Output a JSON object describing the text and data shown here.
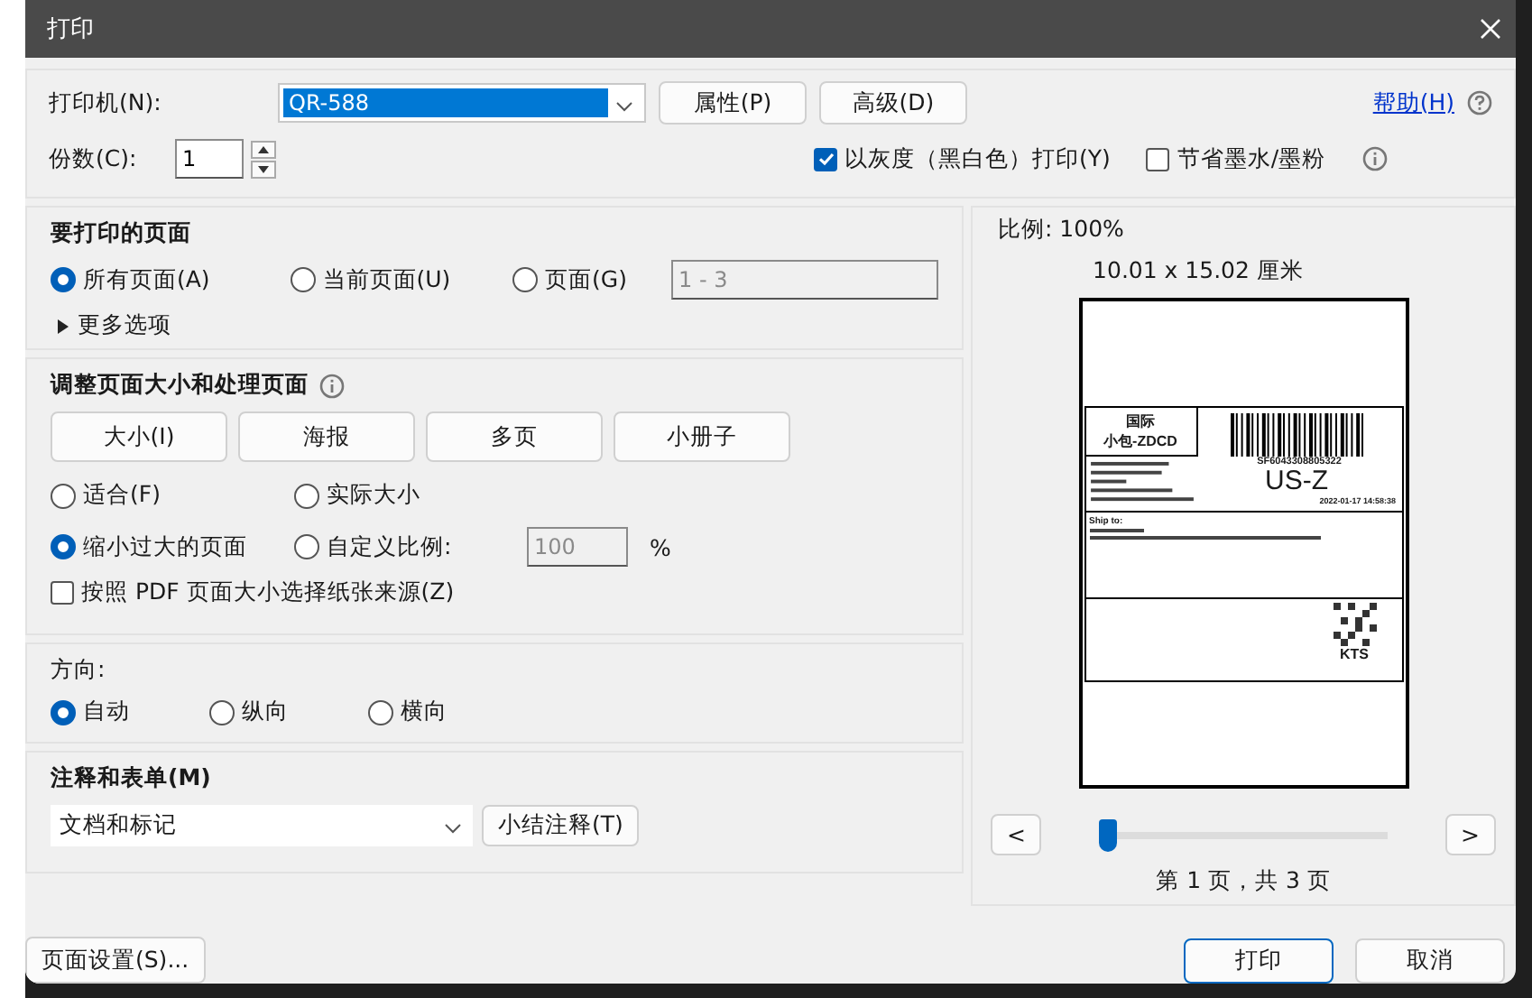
{
  "window": {
    "title": "打印"
  },
  "printer": {
    "label": "打印机(N):",
    "value": "QR-588",
    "buttons": [
      "属性(P)",
      "高级(D)"
    ]
  },
  "help_link": "帮助(H)",
  "copies": {
    "label": "份数(C):",
    "value": "1"
  },
  "options": [
    {
      "label": "以灰度（黑白色）打印(Y)",
      "checked": true
    },
    {
      "label": "节省墨水/墨粉",
      "checked": false
    }
  ],
  "pages_section": {
    "title": "要打印的页面",
    "radios": [
      {
        "label": "所有页面(A)",
        "selected": true
      },
      {
        "label": "当前页面(U)",
        "selected": false
      },
      {
        "label": "页面(G)",
        "selected": false
      }
    ],
    "range_value": "1 - 3",
    "more": "更多选项"
  },
  "size_section": {
    "title": "调整页面大小和处理页面",
    "modes": [
      "大小(I)",
      "海报",
      "多页",
      "小册子"
    ],
    "radios": [
      {
        "label": "适合(F)",
        "selected": false
      },
      {
        "label": "实际大小",
        "selected": false
      },
      {
        "label": "缩小过大的页面",
        "selected": true
      },
      {
        "label": "自定义比例:",
        "selected": false
      }
    ],
    "scale_value": "100",
    "percent": "%",
    "paper_source": {
      "label": "按照 PDF 页面大小选择纸张来源(Z)",
      "checked": false
    }
  },
  "orientation": {
    "title": "方向:",
    "radios": [
      {
        "label": "自动",
        "selected": true
      },
      {
        "label": "纵向",
        "selected": false
      },
      {
        "label": "横向",
        "selected": false
      }
    ]
  },
  "annotations": {
    "title": "注释和表单(M)",
    "value": "文档和标记",
    "button": "小结注释(T)"
  },
  "preview": {
    "scale": "比例: 100%",
    "size": "10.01 x 15.02 厘米",
    "label": {
      "service": "国际",
      "product": "小包-ZDCD",
      "tracking": "SF6043308805322",
      "zone": "US-Z",
      "date": "2022-01-17 14:58:38",
      "ship_to": "Ship to:",
      "carrier": "KTS"
    },
    "prev": "<",
    "next": ">",
    "slider": {
      "level": 0
    },
    "page_info": "第 1 页，共 3 页"
  },
  "page_setup_button": "页面设置(S)...",
  "footer_buttons": [
    {
      "label": "打印",
      "kind": "primary"
    },
    {
      "label": "取消",
      "kind": "normal"
    }
  ]
}
